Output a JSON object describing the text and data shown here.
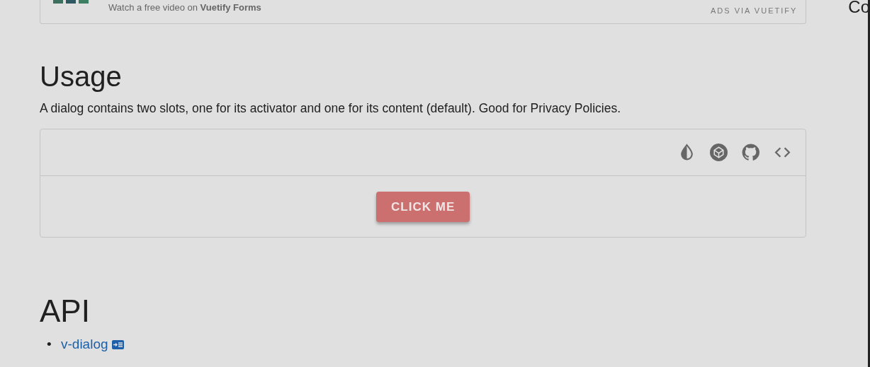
{
  "ad": {
    "text": "Watch a free video on **Vuetify Forms**",
    "label": "ADS VIA VUETIFY"
  },
  "side_heading": "Co",
  "usage": {
    "title": "Usage",
    "description": "A dialog contains two slots, one for its activator and one for its content (default). Good for Privacy Policies.",
    "button": "CLICK ME"
  },
  "api": {
    "title": "API",
    "links": [
      {
        "bullet": "•",
        "label": "v-dialog"
      }
    ]
  }
}
